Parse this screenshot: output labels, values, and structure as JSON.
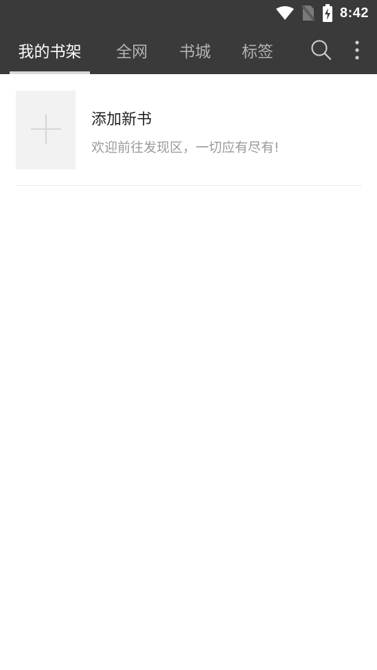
{
  "status_bar": {
    "time": "8:42",
    "icons": [
      "wifi-icon",
      "no-sim-icon",
      "battery-charging-icon"
    ]
  },
  "toolbar": {
    "tabs": [
      {
        "label": "我的书架",
        "active": true
      },
      {
        "label": "全网",
        "active": false
      },
      {
        "label": "书城",
        "active": false
      },
      {
        "label": "标签",
        "active": false
      }
    ],
    "actions": [
      "search-icon",
      "more-vertical-icon"
    ]
  },
  "bookshelf": {
    "add_book": {
      "title": "添加新书",
      "subtitle": "欢迎前往发现区，一切应有尽有!"
    }
  },
  "colors": {
    "toolbar_bg": "#3a3a3a",
    "tab_active": "#ffffff",
    "tab_inactive": "#b3b3b3",
    "indicator": "#d9d9d9",
    "cover_bg": "#f2f2f2",
    "plus": "#d6d6d6"
  }
}
